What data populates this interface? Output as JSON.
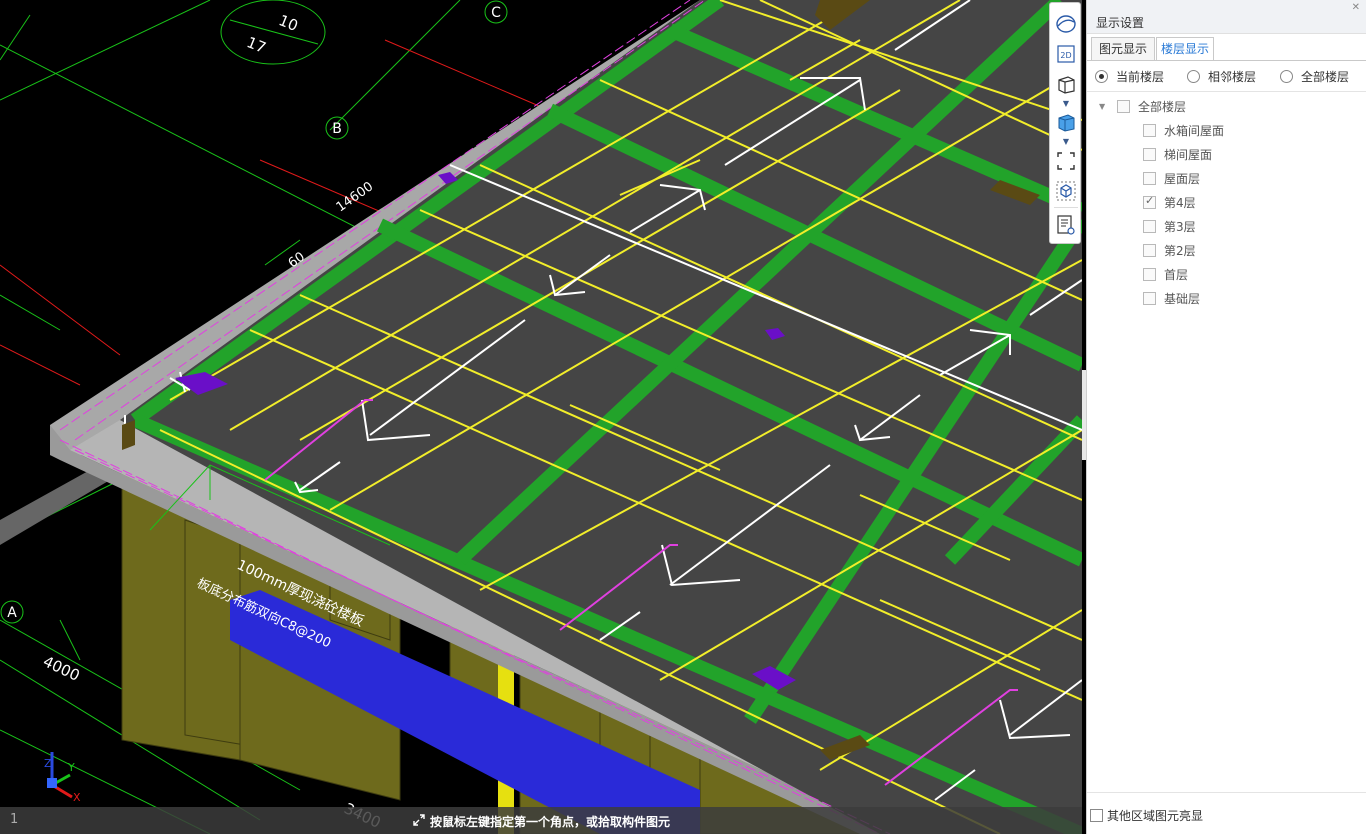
{
  "viewport": {
    "floor_number": "1",
    "labels": {
      "axis_c": "C",
      "axis_b": "B",
      "axis_a": "A",
      "bubble_top": "10",
      "bubble_bottom": "17",
      "dim_14600": "14600",
      "dim_60": "60",
      "dim_4000": "4000",
      "dim_3400": "3400",
      "slab_note_1": "100mm厚现浇砼楼板",
      "slab_note_2": "板底分布筋双向C8@200"
    },
    "axis_gizmo": {
      "x": "X",
      "y": "Y",
      "z": "Z"
    },
    "colors": {
      "background": "#000000",
      "slab": "#454545",
      "beam_green": "#22a32a",
      "rebar_yellow": "#f2ee2a",
      "column_olive": "#6e6a1c",
      "edge_gray": "#a8a8a8",
      "purple": "#6a0fc8",
      "blue_beam": "#2a2ad8",
      "magenta": "#e040e0"
    }
  },
  "toolbar": {
    "icons": [
      "orbit-icon",
      "2d-view-icon",
      "3d-box-icon",
      "solid-box-icon",
      "marquee-select-icon",
      "isometric-view-icon",
      "properties-view-icon"
    ],
    "label_2d": "2D"
  },
  "status": {
    "message": "按鼠标左键指定第一个角点，或拾取构件图元"
  },
  "panel": {
    "title": "显示设置",
    "tabs": [
      {
        "label": "图元显示",
        "active": false
      },
      {
        "label": "楼层显示",
        "active": true
      }
    ],
    "radios": [
      {
        "label": "当前楼层",
        "checked": true
      },
      {
        "label": "相邻楼层",
        "checked": false
      },
      {
        "label": "全部楼层",
        "checked": false
      }
    ],
    "tree_root": {
      "label": "全部楼层",
      "checked": false
    },
    "floors": [
      {
        "label": "水箱间屋面",
        "checked": false
      },
      {
        "label": "梯间屋面",
        "checked": false
      },
      {
        "label": "屋面层",
        "checked": false
      },
      {
        "label": "第4层",
        "checked": true
      },
      {
        "label": "第3层",
        "checked": false
      },
      {
        "label": "第2层",
        "checked": false
      },
      {
        "label": "首层",
        "checked": false
      },
      {
        "label": "基础层",
        "checked": false
      }
    ],
    "bottom_option": {
      "label": "其他区域图元亮显",
      "checked": false
    }
  }
}
